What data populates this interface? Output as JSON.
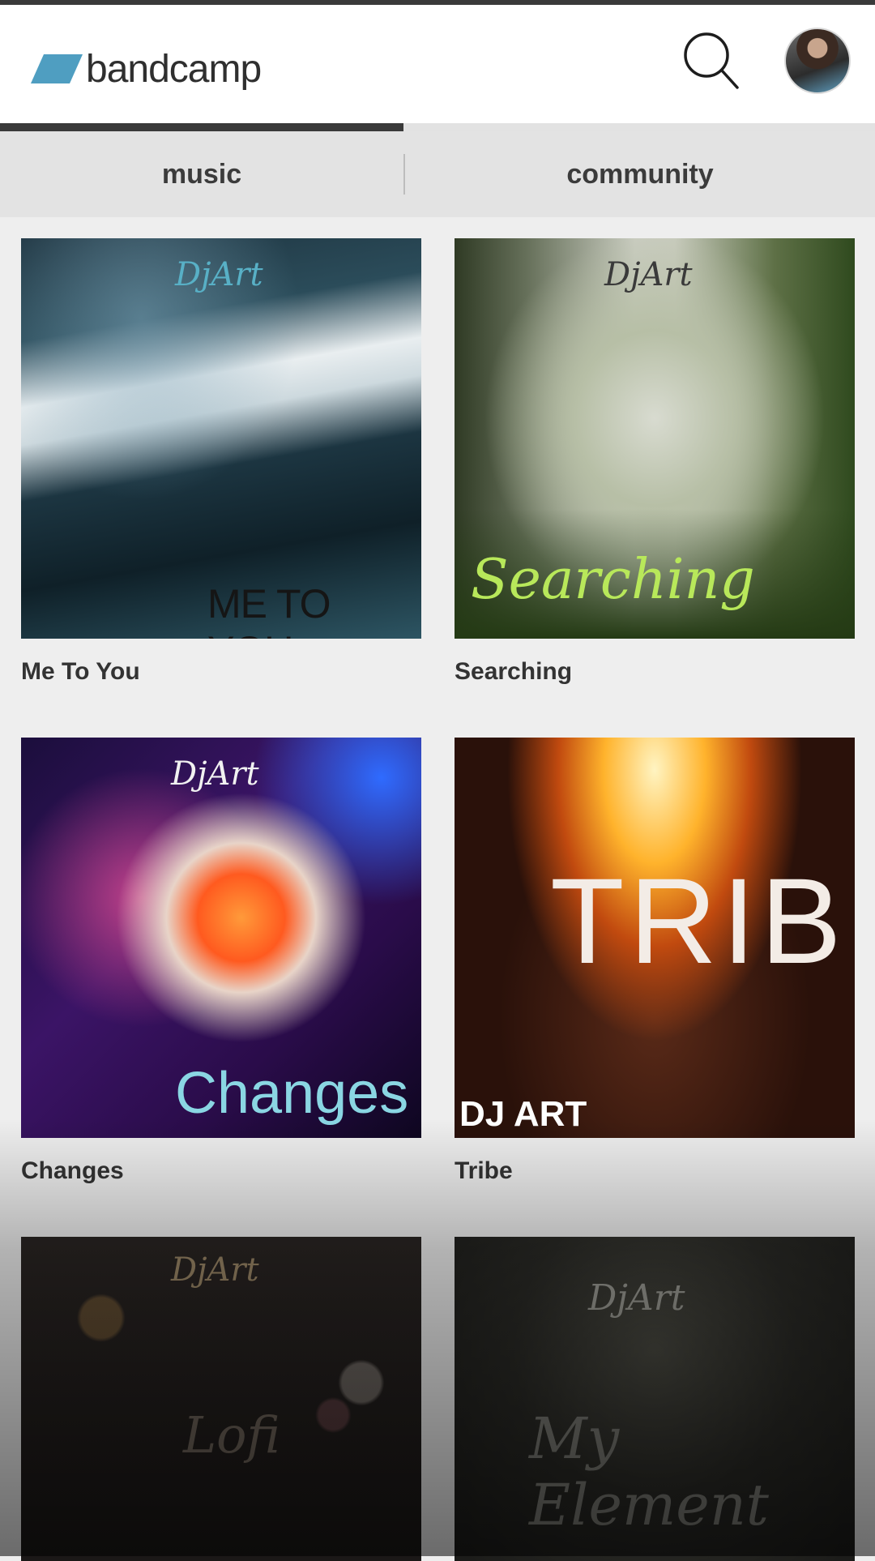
{
  "header": {
    "logo_text": "bandcamp",
    "brand_color": "#4f9ec1",
    "search_icon": "search-icon",
    "avatar_icon": "user-avatar"
  },
  "tabs": [
    {
      "label": "music",
      "active": true
    },
    {
      "label": "community",
      "active": false
    }
  ],
  "albums": [
    {
      "title": "Me To You",
      "art_text": "ME TO YOU",
      "art_logo": "DjArt"
    },
    {
      "title": "Searching",
      "art_text": "Searching",
      "art_logo": "DjArt"
    },
    {
      "title": "Changes",
      "art_text": "Changes",
      "art_logo": "DjArt"
    },
    {
      "title": "Tribe",
      "art_text": "TRIBE",
      "art_badge": "DJ ART"
    },
    {
      "title": "",
      "art_text": "Lofi",
      "art_logo": "DjArt"
    },
    {
      "title": "",
      "art_text": "My Element",
      "art_logo": "DjArt"
    }
  ]
}
